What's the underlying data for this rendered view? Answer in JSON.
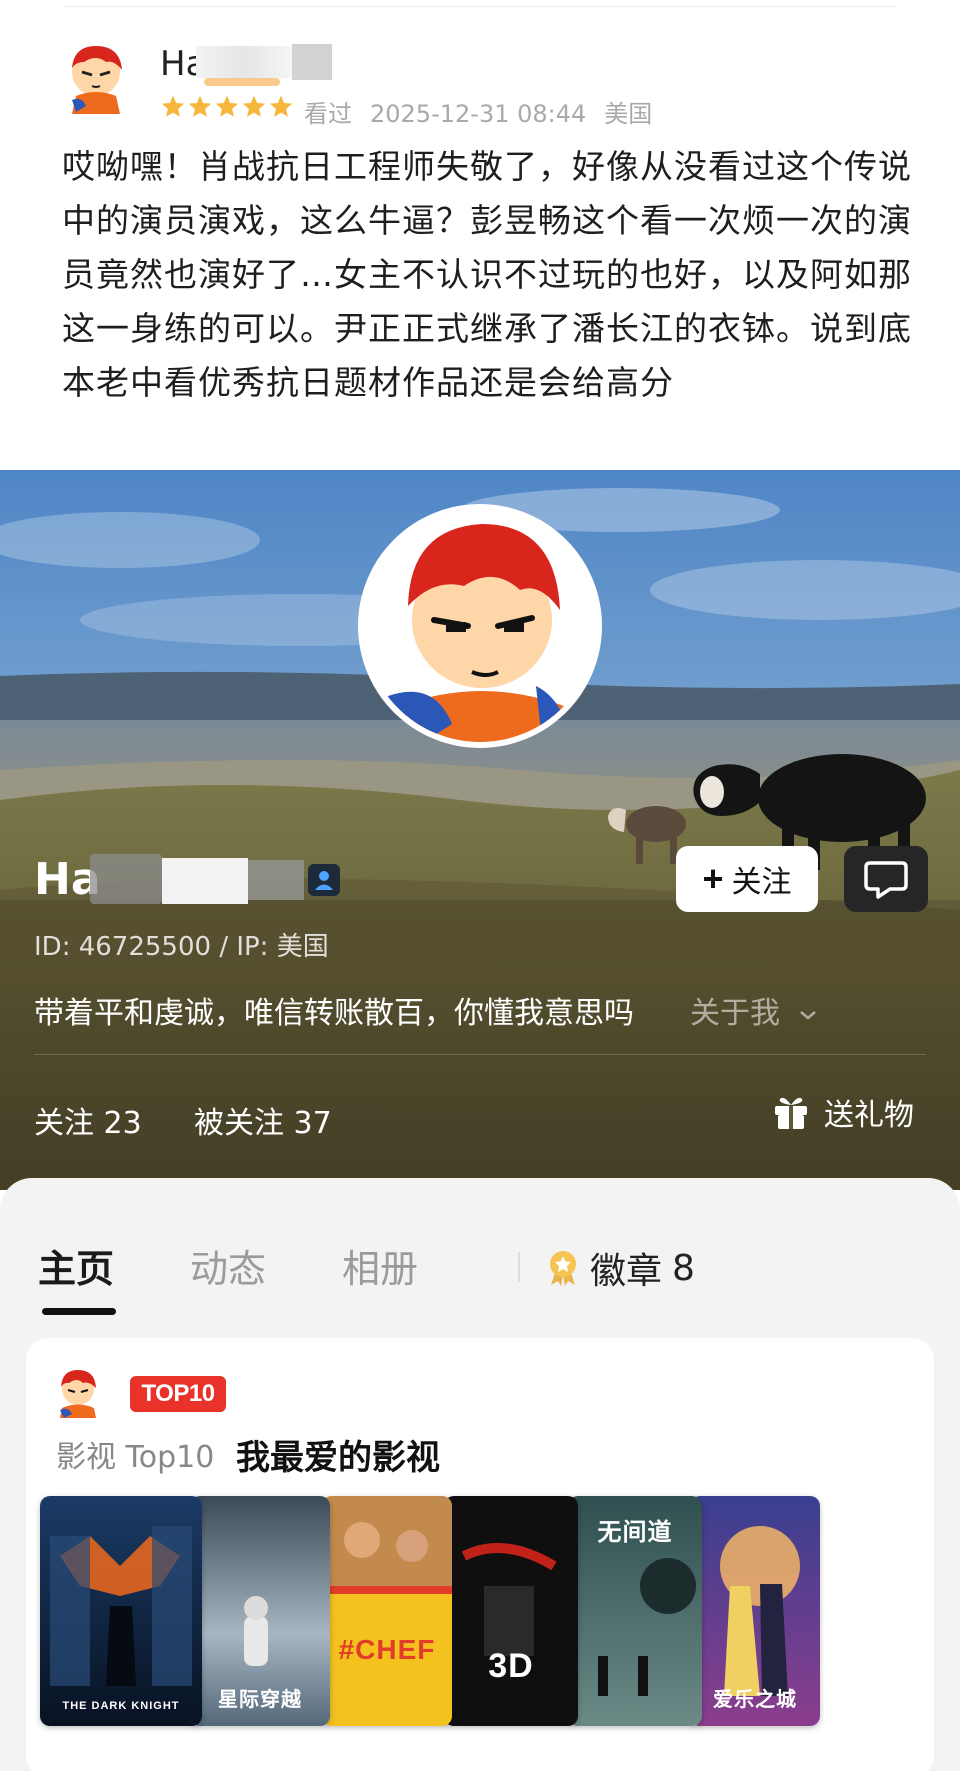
{
  "review": {
    "user_name": "Ha",
    "rating": 5,
    "status": "看过",
    "datetime": "2025-12-31 08:44",
    "location": "美国",
    "text": "哎呦嘿！肖战抗日工程师失敬了，好像从没看过这个传说中的演员演戏，这么牛逼？彭昱畅这个看一次烦一次的演员竟然也演好了…女主不认识不过玩的也好，以及阿如那这一身练的可以。尹正正式继承了潘长江的衣钵。说到底本老中看优秀抗日题材作品还是会给高分"
  },
  "profile": {
    "name": "Ha",
    "id_line": "ID: 46725500 / IP: 美国",
    "follow_label": "关注",
    "bio": "带着平和虔诚，唯信转账散百，你懂我意思吗",
    "about_label": "关于我",
    "following": "关注 23",
    "followers": "被关注 37",
    "gift_label": "送礼物"
  },
  "tabs": [
    {
      "label": "主页",
      "active": true
    },
    {
      "label": "动态",
      "active": false
    },
    {
      "label": "相册",
      "active": false
    }
  ],
  "badges_tab": {
    "label": "徽章",
    "count": "8"
  },
  "top10": {
    "badge": "TOP10",
    "subtitle": "影视 Top10",
    "title": "我最爱的影视"
  },
  "posters": [
    {
      "caption": "THE DARK KNIGHT",
      "palette": "dark-blue"
    },
    {
      "caption": "星际穿越",
      "palette": "grey-blue"
    },
    {
      "caption": "#CHEF",
      "palette": "yellow"
    },
    {
      "caption": "3D",
      "palette": "black-red"
    },
    {
      "caption": "无间道",
      "palette": "teal"
    },
    {
      "caption": "爱乐之城",
      "palette": "purple"
    }
  ],
  "colors": {
    "star": "#f6b73c",
    "top10_badge": "#e8322a",
    "sky": "#5f8fbf",
    "grass": "#6d6a36"
  }
}
